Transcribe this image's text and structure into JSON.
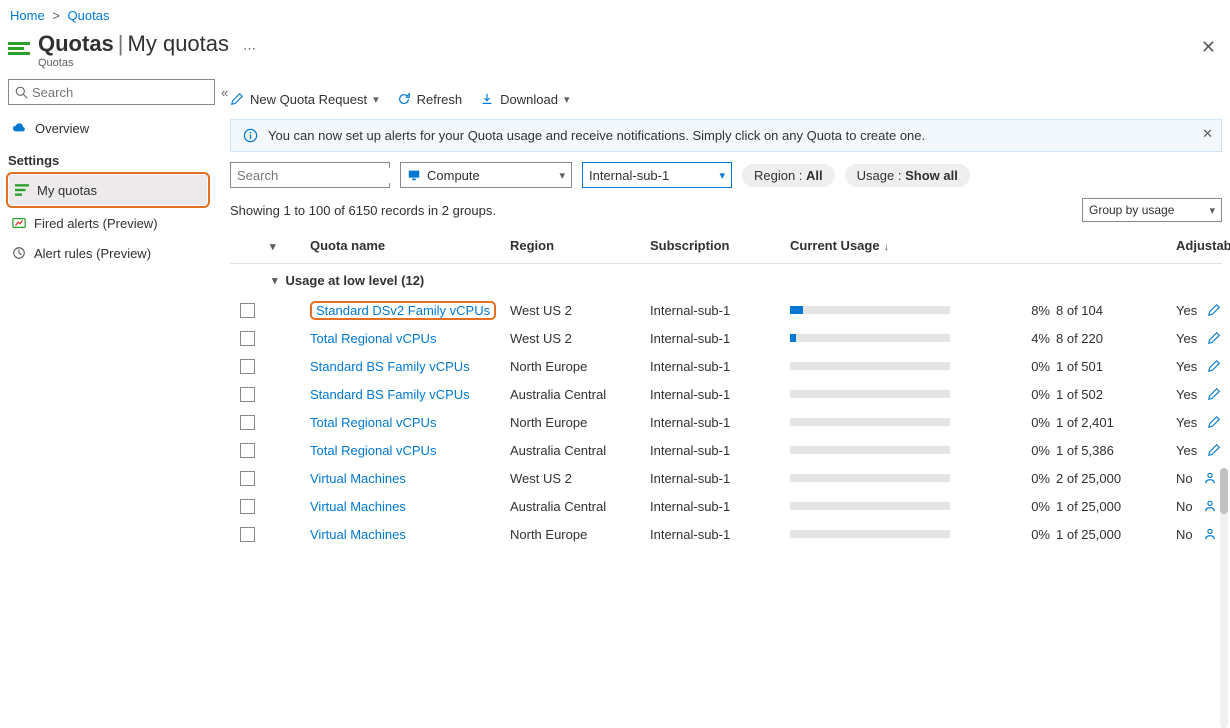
{
  "breadcrumb": {
    "home": "Home",
    "quotas": "Quotas"
  },
  "header": {
    "title": "Quotas",
    "subpage": "My quotas",
    "subtitle": "Quotas"
  },
  "sidebar": {
    "search_placeholder": "Search",
    "overview": "Overview",
    "section_label": "Settings",
    "my_quotas": "My quotas",
    "fired_alerts": "Fired alerts (Preview)",
    "alert_rules": "Alert rules (Preview)"
  },
  "toolbar": {
    "new_quota": "New Quota Request",
    "refresh": "Refresh",
    "download": "Download"
  },
  "banner": {
    "text": "You can now set up alerts for your Quota usage and receive notifications. Simply click on any Quota to create one."
  },
  "filters": {
    "search_placeholder": "Search",
    "compute": "Compute",
    "subscription": "Internal-sub-1",
    "region_label": "Region :",
    "region_value": "All",
    "usage_label": "Usage :",
    "usage_value": "Show all"
  },
  "records_line": "Showing 1 to 100 of 6150 records in 2 groups.",
  "groupby_label": "Group by usage",
  "columns": {
    "name": "Quota name",
    "region": "Region",
    "subscription": "Subscription",
    "usage": "Current Usage",
    "adjustable": "Adjustable"
  },
  "group_header": "Usage at low level (12)",
  "rows": [
    {
      "name": "Standard DSv2 Family vCPUs",
      "region": "West US 2",
      "sub": "Internal-sub-1",
      "pct": "8%",
      "usage": "8 of 104",
      "adj": "Yes",
      "bar": 8,
      "hl": true,
      "iconType": "pencil"
    },
    {
      "name": "Total Regional vCPUs",
      "region": "West US 2",
      "sub": "Internal-sub-1",
      "pct": "4%",
      "usage": "8 of 220",
      "adj": "Yes",
      "bar": 4,
      "iconType": "pencil"
    },
    {
      "name": "Standard BS Family vCPUs",
      "region": "North Europe",
      "sub": "Internal-sub-1",
      "pct": "0%",
      "usage": "1 of 501",
      "adj": "Yes",
      "bar": 0,
      "iconType": "pencil"
    },
    {
      "name": "Standard BS Family vCPUs",
      "region": "Australia Central",
      "sub": "Internal-sub-1",
      "pct": "0%",
      "usage": "1 of 502",
      "adj": "Yes",
      "bar": 0,
      "iconType": "pencil"
    },
    {
      "name": "Total Regional vCPUs",
      "region": "North Europe",
      "sub": "Internal-sub-1",
      "pct": "0%",
      "usage": "1 of 2,401",
      "adj": "Yes",
      "bar": 0,
      "iconType": "pencil"
    },
    {
      "name": "Total Regional vCPUs",
      "region": "Australia Central",
      "sub": "Internal-sub-1",
      "pct": "0%",
      "usage": "1 of 5,386",
      "adj": "Yes",
      "bar": 0,
      "iconType": "pencil"
    },
    {
      "name": "Virtual Machines",
      "region": "West US 2",
      "sub": "Internal-sub-1",
      "pct": "0%",
      "usage": "2 of 25,000",
      "adj": "No",
      "bar": 0,
      "iconType": "person"
    },
    {
      "name": "Virtual Machines",
      "region": "Australia Central",
      "sub": "Internal-sub-1",
      "pct": "0%",
      "usage": "1 of 25,000",
      "adj": "No",
      "bar": 0,
      "iconType": "person"
    },
    {
      "name": "Virtual Machines",
      "region": "North Europe",
      "sub": "Internal-sub-1",
      "pct": "0%",
      "usage": "1 of 25,000",
      "adj": "No",
      "bar": 0,
      "iconType": "person"
    }
  ]
}
